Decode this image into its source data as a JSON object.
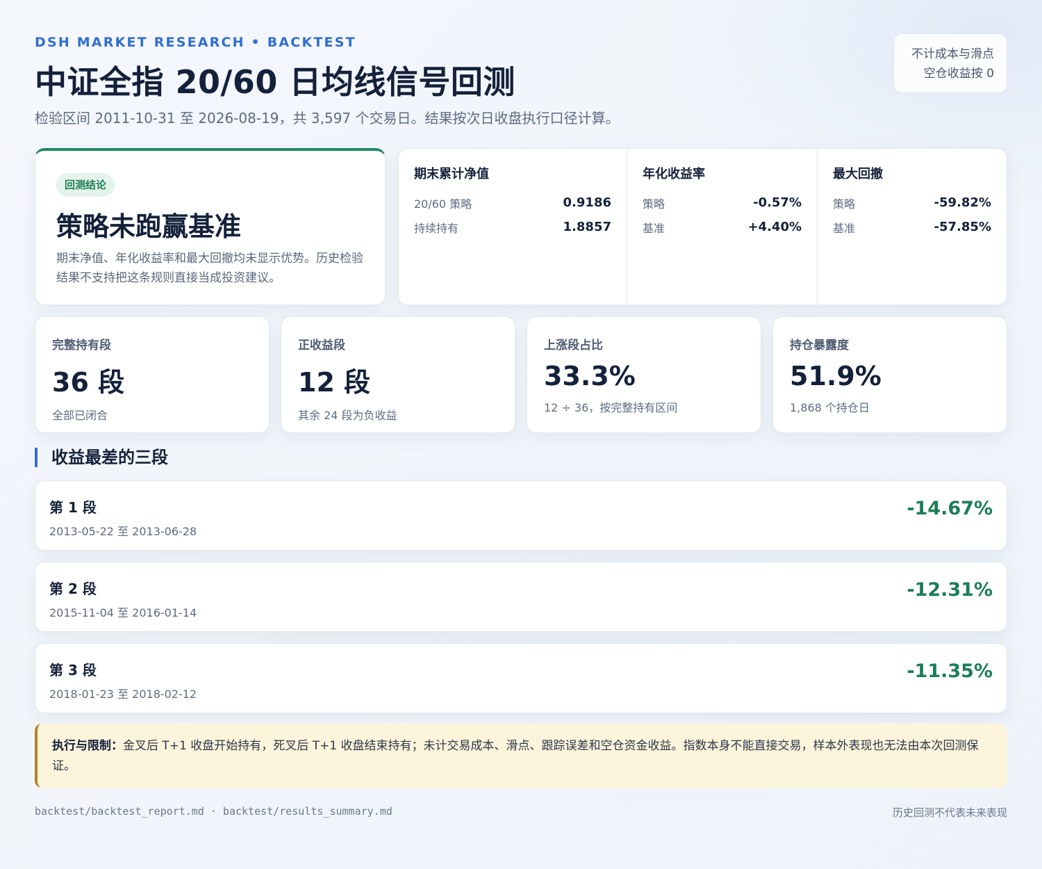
{
  "header": {
    "kicker": "DSH MARKET RESEARCH • BACKTEST",
    "title": "中证全指 20/60 日均线信号回测",
    "subtitle": "检验区间 2011-10-31 至 2026-08-19，共 3,597 个交易日。结果按次日收盘执行口径计算。",
    "note_line1": "不计成本与滑点",
    "note_line2": "空仓收益按 0"
  },
  "verdict": {
    "badge": "回测结论",
    "title": "策略未跑赢基准",
    "description": "期末净值、年化收益率和最大回撤均未显示优势。历史检验结果不支持把这条规则直接当成投资建议。",
    "accent_color": "#1f8a63"
  },
  "metrics": [
    {
      "title": "期末累计净值",
      "rows": [
        {
          "label": "20/60 策略",
          "value": "0.9186"
        },
        {
          "label": "持续持有",
          "value": "1.8857"
        }
      ]
    },
    {
      "title": "年化收益率",
      "rows": [
        {
          "label": "策略",
          "value": "-0.57%"
        },
        {
          "label": "基准",
          "value": "+4.40%"
        }
      ]
    },
    {
      "title": "最大回撤",
      "rows": [
        {
          "label": "策略",
          "value": "-59.82%"
        },
        {
          "label": "基准",
          "value": "-57.85%"
        }
      ]
    }
  ],
  "stats": [
    {
      "label": "完整持有段",
      "value": "36 段",
      "note": "全部已闭合"
    },
    {
      "label": "正收益段",
      "value": "12 段",
      "note": "其余 24 段为负收益"
    },
    {
      "label": "上涨段占比",
      "value": "33.3%",
      "note": "12 ÷ 36，按完整持有区间"
    },
    {
      "label": "持仓暴露度",
      "value": "51.9%",
      "note": "1,868 个持仓日"
    }
  ],
  "worst_section": {
    "title": "收益最差的三段",
    "segments": [
      {
        "name": "第 1 段",
        "range": "2013-05-22 至 2013-06-28",
        "return": "-14.67%"
      },
      {
        "name": "第 2 段",
        "range": "2015-11-04 至 2016-01-14",
        "return": "-12.31%"
      },
      {
        "name": "第 3 段",
        "range": "2018-01-23 至 2018-02-12",
        "return": "-11.35%"
      }
    ]
  },
  "caveat": {
    "label": "执行与限制：",
    "text": "金叉后 T+1 收盘开始持有，死叉后 T+1 收盘结束持有；未计交易成本、滑点、跟踪误差和空仓资金收益。指数本身不能直接交易，样本外表现也无法由本次回测保证。"
  },
  "footer": {
    "sources": "backtest/backtest_report.md · backtest/results_summary.md",
    "disclaimer": "历史回测不代表未来表现"
  },
  "colors": {
    "accent_blue": "#2f6fd0",
    "negative_return": "#1d7e56",
    "caveat_bar": "#b88324"
  }
}
